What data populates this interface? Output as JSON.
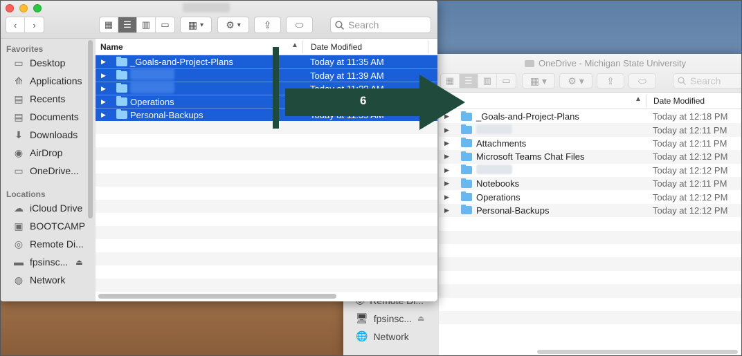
{
  "back_window": {
    "title": "OneDrive - Michigan State University",
    "search_placeholder": "Search",
    "column_date": "Date Modified",
    "sidebar": [
      {
        "label": "Remote Di...",
        "icon": "remote-disc-icon"
      },
      {
        "label": "fpsinsc...",
        "icon": "computer-icon"
      },
      {
        "label": "Network",
        "icon": "network-icon"
      }
    ],
    "rows": [
      {
        "name": "_Goals-and-Project-Plans",
        "date": "Today at 12:18 PM",
        "blurred": false
      },
      {
        "name": "",
        "date": "Today at 12:11 PM",
        "blurred": true
      },
      {
        "name": "Attachments",
        "date": "Today at 12:11 PM",
        "blurred": false
      },
      {
        "name": "Microsoft Teams Chat Files",
        "date": "Today at 12:12 PM",
        "blurred": false
      },
      {
        "name": "",
        "date": "Today at 12:12 PM",
        "blurred": true
      },
      {
        "name": "Notebooks",
        "date": "Today at 12:11 PM",
        "blurred": false
      },
      {
        "name": "Operations",
        "date": "Today at 12:12 PM",
        "blurred": false
      },
      {
        "name": "Personal-Backups",
        "date": "Today at 12:12 PM",
        "blurred": false
      }
    ]
  },
  "front_window": {
    "search_placeholder": "Search",
    "column_name": "Name",
    "column_date": "Date Modified",
    "favorites_heading": "Favorites",
    "locations_heading": "Locations",
    "favorites": [
      {
        "label": "Desktop",
        "icon": "desktop-icon"
      },
      {
        "label": "Applications",
        "icon": "applications-icon"
      },
      {
        "label": "Recents",
        "icon": "recents-icon"
      },
      {
        "label": "Documents",
        "icon": "documents-icon"
      },
      {
        "label": "Downloads",
        "icon": "downloads-icon"
      },
      {
        "label": "AirDrop",
        "icon": "airdrop-icon"
      },
      {
        "label": "OneDrive...",
        "icon": "folder-icon"
      }
    ],
    "locations": [
      {
        "label": "iCloud Drive",
        "icon": "cloud-icon"
      },
      {
        "label": "BOOTCAMP",
        "icon": "disk-icon"
      },
      {
        "label": "Remote Di...",
        "icon": "remote-disc-icon"
      },
      {
        "label": "fpsinsc...",
        "icon": "computer-icon"
      },
      {
        "label": "Network",
        "icon": "network-icon"
      }
    ],
    "rows": [
      {
        "name": "_Goals-and-Project-Plans",
        "date": "Today at 11:35 AM",
        "blurred": false
      },
      {
        "name": "",
        "date": "Today at 11:39 AM",
        "blurred": true
      },
      {
        "name": "",
        "date": "Today at 11:?? AM",
        "blurred": true
      },
      {
        "name": "Operations",
        "date": "Today at 11:35 AM",
        "blurred": false
      },
      {
        "name": "Personal-Backups",
        "date": "Today at 11:35 AM",
        "blurred": false
      }
    ]
  },
  "callout": {
    "step": "6",
    "color": "#1f4a3c"
  },
  "colors": {
    "selection": "#1a5fd8",
    "folder": "#69b7ef"
  }
}
